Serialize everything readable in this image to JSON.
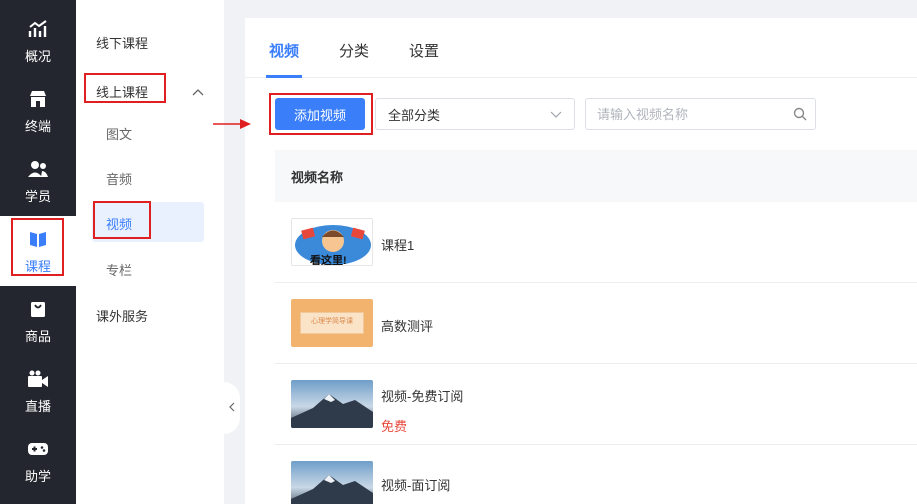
{
  "nav": {
    "items": [
      {
        "label": "概况",
        "icon": "chart-trend-icon"
      },
      {
        "label": "终端",
        "icon": "store-icon"
      },
      {
        "label": "学员",
        "icon": "users-icon"
      },
      {
        "label": "课程",
        "icon": "book-icon"
      },
      {
        "label": "商品",
        "icon": "bag-icon"
      },
      {
        "label": "直播",
        "icon": "video-camera-icon"
      },
      {
        "label": "助学",
        "icon": "gamepad-icon"
      }
    ],
    "active_index": 3
  },
  "subnav": {
    "offline_courses": "线下课程",
    "online_courses": "线上课程",
    "children": [
      "图文",
      "音频",
      "视频",
      "专栏"
    ],
    "active_child": "视频",
    "extra_services": "课外服务"
  },
  "tabs": [
    "视频",
    "分类",
    "设置"
  ],
  "active_tab": "视频",
  "toolbar": {
    "add_label": "添加视频",
    "category_selected": "全部分类",
    "search_placeholder": "请输入视频名称"
  },
  "table": {
    "column_header": "视频名称",
    "rows": [
      {
        "title": "课程1",
        "badge": "",
        "thumb_text": "看这里!"
      },
      {
        "title": "高数测评",
        "badge": "",
        "thumb_text": "心理学简导课"
      },
      {
        "title": "视频-免费订阅",
        "badge": "免费",
        "thumb_text": ""
      },
      {
        "title": "视频-面订阅",
        "badge": "",
        "thumb_text": ""
      }
    ]
  },
  "colors": {
    "accent": "#3a7efa",
    "nav_bg": "#23262e",
    "annotation_red": "#e02020",
    "free_badge": "#e8483c"
  }
}
